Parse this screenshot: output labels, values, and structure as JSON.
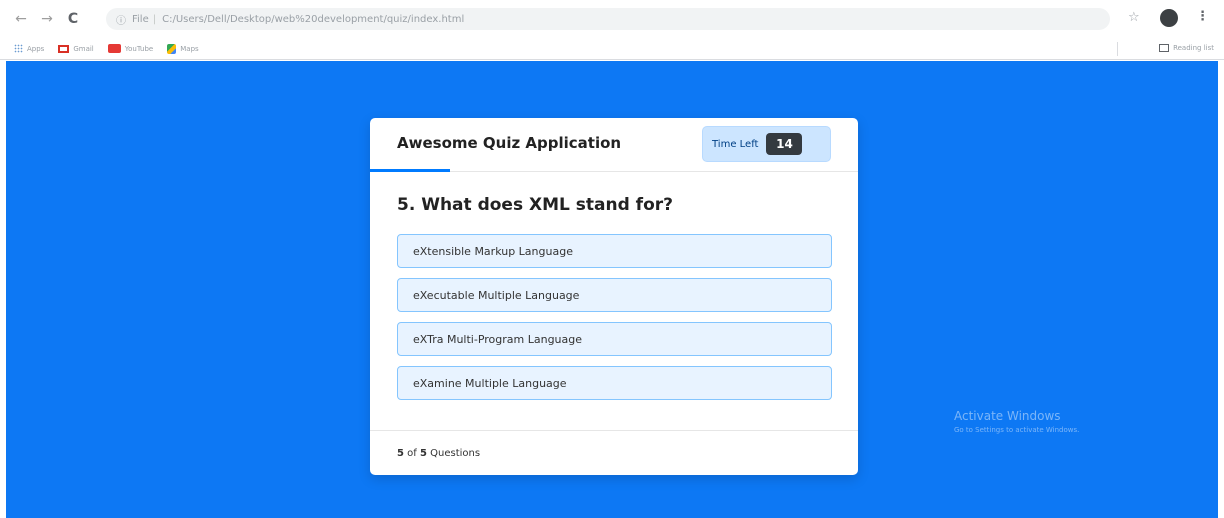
{
  "browser": {
    "back_icon": "back-arrow-icon",
    "forward_icon": "forward-arrow-icon",
    "reload_icon": "reload-icon",
    "address_scheme": "File",
    "address_path": "C:/Users/Dell/Desktop/web%20development/quiz/index.html",
    "bookmarks": [
      {
        "label": "Apps",
        "icon": "apps-icon"
      },
      {
        "label": "Gmail",
        "icon": "gmail-icon"
      },
      {
        "label": "YouTube",
        "icon": "youtube-icon"
      },
      {
        "label": "Maps",
        "icon": "maps-icon"
      }
    ],
    "reading_list": "Reading list"
  },
  "quiz": {
    "title": "Awesome Quiz Application",
    "timer_label": "Time Left",
    "timer_seconds": "14",
    "question": "5. What does XML stand for?",
    "options": [
      "eXtensible Markup Language",
      "eXecutable Multiple Language",
      "eXTra Multi-Program Language",
      "eXamine Multiple Language"
    ],
    "progress_current": "5",
    "progress_of": "of",
    "progress_total": "5",
    "progress_suffix": "Questions"
  },
  "watermark": {
    "title": "Activate Windows",
    "subtitle": "Go to Settings to activate Windows."
  },
  "colors": {
    "page_background": "#0d78f4",
    "accent": "#007bff",
    "timer_bg": "#cce5ff",
    "option_bg": "#e8f3ff",
    "option_border": "#84c5fe"
  }
}
